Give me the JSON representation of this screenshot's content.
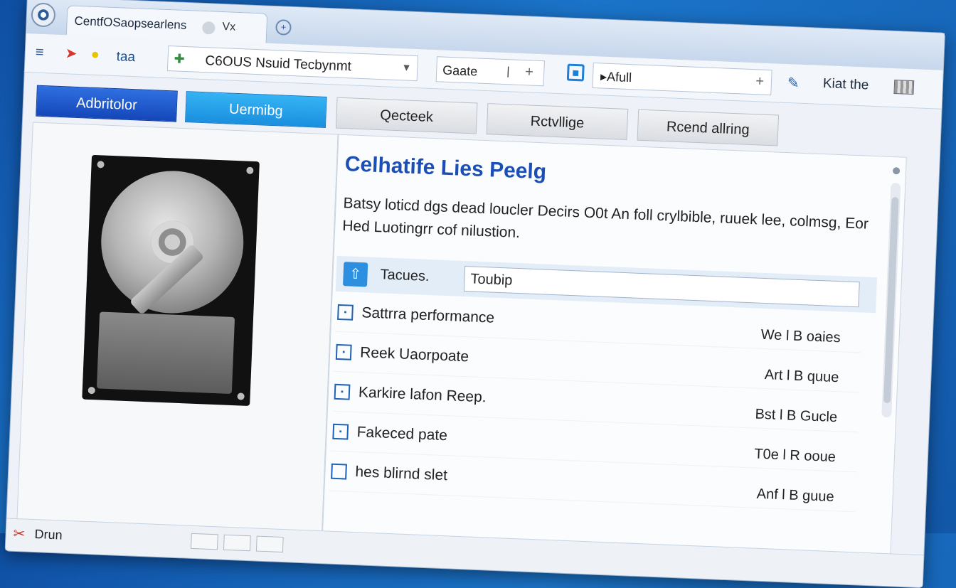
{
  "tab": {
    "title": "CentfOSaopsearlens",
    "close": "x",
    "close_prefix": "V"
  },
  "toolbar": {
    "icons": [
      "menu-icon",
      "red-arrow-icon",
      "yellow-circle-icon"
    ],
    "label": "taa",
    "address": {
      "icon": "network-icon",
      "value": "C6OUS Nsuid Tecbynmt"
    },
    "search": {
      "value": "Gaate",
      "sep": "|"
    },
    "field2": {
      "value": "▸Afull"
    },
    "right_text": "Kiat the"
  },
  "window_controls": {
    "min": "≡",
    "max": "□",
    "close": "➔"
  },
  "actions": [
    {
      "label": "Adbritolor",
      "style": "primary"
    },
    {
      "label": "Uermibg",
      "style": "light"
    },
    {
      "label": "Qecteek",
      "style": "gray"
    },
    {
      "label": "Rctvllige",
      "style": "gray"
    },
    {
      "label": "Rcend allring",
      "style": "gray"
    }
  ],
  "content": {
    "title": "Celhatife Lies Peelg",
    "description": "Batsy loticd dgs dead loucler Decirs O0t An foll crylbible, ruuek lee, colmsg, Eor Hed Luotingrr cof nilustion.",
    "filter": {
      "label": "Tacues.",
      "value": "Toubip"
    },
    "items": [
      {
        "name": "Sattrra performance",
        "value": "We l B oaies"
      },
      {
        "name": "Reek Uaorpoate",
        "value": "Art l B quue"
      },
      {
        "name": "Karkire lafon Reep.",
        "value": "Bst l B Gucle"
      },
      {
        "name": "Fakeced pate",
        "value": "T0e l R ooue"
      },
      {
        "name": "hes blirnd slet",
        "value": "Anf l B guue"
      }
    ]
  },
  "status": {
    "text": "Drun"
  }
}
